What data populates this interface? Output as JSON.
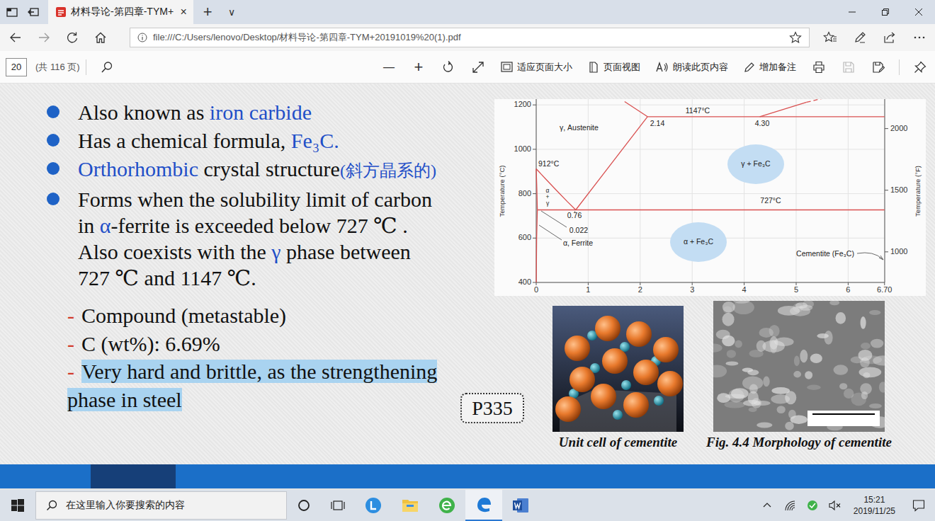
{
  "title_bar": {
    "tabs": [
      {
        "label": "材料导论-第四章-TYM+",
        "selected": true,
        "close": "×"
      }
    ],
    "new_tab": "+",
    "tab_list": "∨"
  },
  "address_bar": {
    "url": "file:///C:/Users/lenovo/Desktop/材料导论-第四章-TYM+20191019%20(1).pdf"
  },
  "pdf_toolbar": {
    "page": "20",
    "page_count": "(共 116 页)",
    "zoom_out": "—",
    "zoom_in": "+",
    "actions": [
      {
        "label": "适应页面大小",
        "kind": "fit"
      },
      {
        "label": "页面视图",
        "kind": "view"
      },
      {
        "label": "朗读此页内容",
        "kind": "read"
      },
      {
        "label": "增加备注",
        "kind": "note"
      }
    ],
    "tools": [
      {
        "kind": "print",
        "disabled": false
      },
      {
        "kind": "save",
        "disabled": true
      },
      {
        "kind": "save-as",
        "disabled": false
      }
    ]
  },
  "slide": {
    "bullets": [
      {
        "lines": [
          [
            {
              "text": "Also known as ",
              "accent": false
            },
            {
              "text": "iron carbide",
              "accent": true
            }
          ]
        ]
      },
      {
        "lines": [
          [
            {
              "text": "Has a chemical formula, ",
              "accent": false
            },
            {
              "text": "Fe₃C.",
              "accent": true
            }
          ]
        ]
      },
      {
        "lines": [
          [
            {
              "text": "Orthorhombic",
              "accent": true
            },
            {
              "text": " crystal structure",
              "accent": false
            }
          ]
        ],
        "gloss": "(斜方晶系的)"
      },
      {
        "lines": [
          [
            {
              "text": "Forms when the solubility limit of carbon",
              "accent": false
            }
          ],
          [
            {
              "text": "in ",
              "accent": false
            },
            {
              "text": "α",
              "accent": true
            },
            {
              "text": "-ferrite is exceeded below 727 ℃ .",
              "accent": false
            }
          ],
          [
            {
              "text": "Also coexists with the ",
              "accent": false
            },
            {
              "text": "γ",
              "accent": true
            },
            {
              "text": " phase between",
              "accent": false
            }
          ],
          [
            {
              "text": "727 ℃ and 1147 ℃.",
              "accent": false
            }
          ]
        ]
      }
    ],
    "notes": [
      {
        "dash": "-",
        "lines": [
          "Compound (metastable)"
        ],
        "highlighted": false
      },
      {
        "dash": "-",
        "lines": [
          "C (wt%): 6.69%"
        ],
        "highlighted": false
      },
      {
        "dash": "-",
        "lines": [
          "Very hard and brittle, as the strengthening",
          "phase in steel"
        ],
        "highlighted": true
      }
    ],
    "page_ref": "P335",
    "figures": [
      {
        "caption": "Unit cell of cementite",
        "kind": "unit-cell"
      },
      {
        "caption": "Fig. 4.4 Morphology of cementite",
        "kind": "micrograph"
      }
    ]
  },
  "diagram": {
    "y_title": "Temperature (°C)",
    "y2_title": "Temperature (°F)",
    "y_ticks": [
      "400",
      "600",
      "800",
      "1000",
      "1200"
    ],
    "y2_ticks": [
      "1000",
      "1500",
      "2000"
    ],
    "x_ticks": [
      "0",
      "1",
      "2",
      "3",
      "4",
      "5",
      "6",
      "6.70"
    ],
    "lines": [
      {
        "points": [
          [
            0,
            912
          ],
          [
            0.2,
            862
          ],
          [
            0.4,
            812
          ],
          [
            0.6,
            764
          ],
          [
            0.76,
            727
          ]
        ],
        "dashed": false
      },
      {
        "points": [
          [
            0.76,
            727
          ],
          [
            2.14,
            1147
          ]
        ],
        "dashed": false
      },
      {
        "points": [
          [
            0.022,
            727
          ],
          [
            6.7,
            727
          ]
        ],
        "dashed": false
      },
      {
        "points": [
          [
            2.14,
            1147
          ],
          [
            6.7,
            1147
          ]
        ],
        "dashed": false
      },
      {
        "points": [
          [
            2.14,
            1147
          ],
          [
            1.7,
            1215
          ]
        ],
        "dashed": false
      },
      {
        "points": [
          [
            4.3,
            1147
          ],
          [
            5.2,
            1212
          ]
        ],
        "dashed": false
      },
      {
        "points": [
          [
            5.2,
            1212
          ],
          [
            5.7,
            1240
          ]
        ],
        "dashed": true
      },
      {
        "points": [
          [
            0,
            912
          ],
          [
            0.012,
            820
          ],
          [
            0.022,
            727
          ]
        ],
        "dashed": false
      },
      {
        "points": [
          [
            0.022,
            727
          ],
          [
            0.008,
            600
          ],
          [
            0.002,
            400
          ]
        ],
        "dashed": false
      }
    ],
    "labels": [
      {
        "text": "γ, Austenite",
        "kind": "plain"
      },
      {
        "text": "912°C",
        "kind": "plain"
      },
      {
        "text": "1147°C",
        "kind": "plain"
      },
      {
        "text": "2.14",
        "kind": "plain"
      },
      {
        "text": "4.30",
        "kind": "plain"
      },
      {
        "text": "727°C",
        "kind": "plain"
      },
      {
        "text": "0.76",
        "kind": "plain"
      },
      {
        "text": "0.022",
        "kind": "plain"
      },
      {
        "text": "α, Ferrite",
        "kind": "plain"
      },
      {
        "text": "α + γ",
        "kind": "stacked"
      },
      {
        "text": "γ + Fe₃C",
        "kind": "region"
      },
      {
        "text": "α + Fe₃C",
        "kind": "region"
      },
      {
        "text": "Cementite (Fe₃C)",
        "kind": "plain"
      }
    ]
  },
  "taskbar": {
    "search_placeholder": "在这里输入你要搜索的内容",
    "apps": [
      {
        "kind": "l-app",
        "selected": false
      },
      {
        "kind": "explorer",
        "selected": false
      },
      {
        "kind": "browser",
        "selected": false
      },
      {
        "kind": "edge",
        "selected": true
      },
      {
        "kind": "word",
        "selected": false
      }
    ],
    "time": "15:21",
    "date": "2019/11/25"
  }
}
